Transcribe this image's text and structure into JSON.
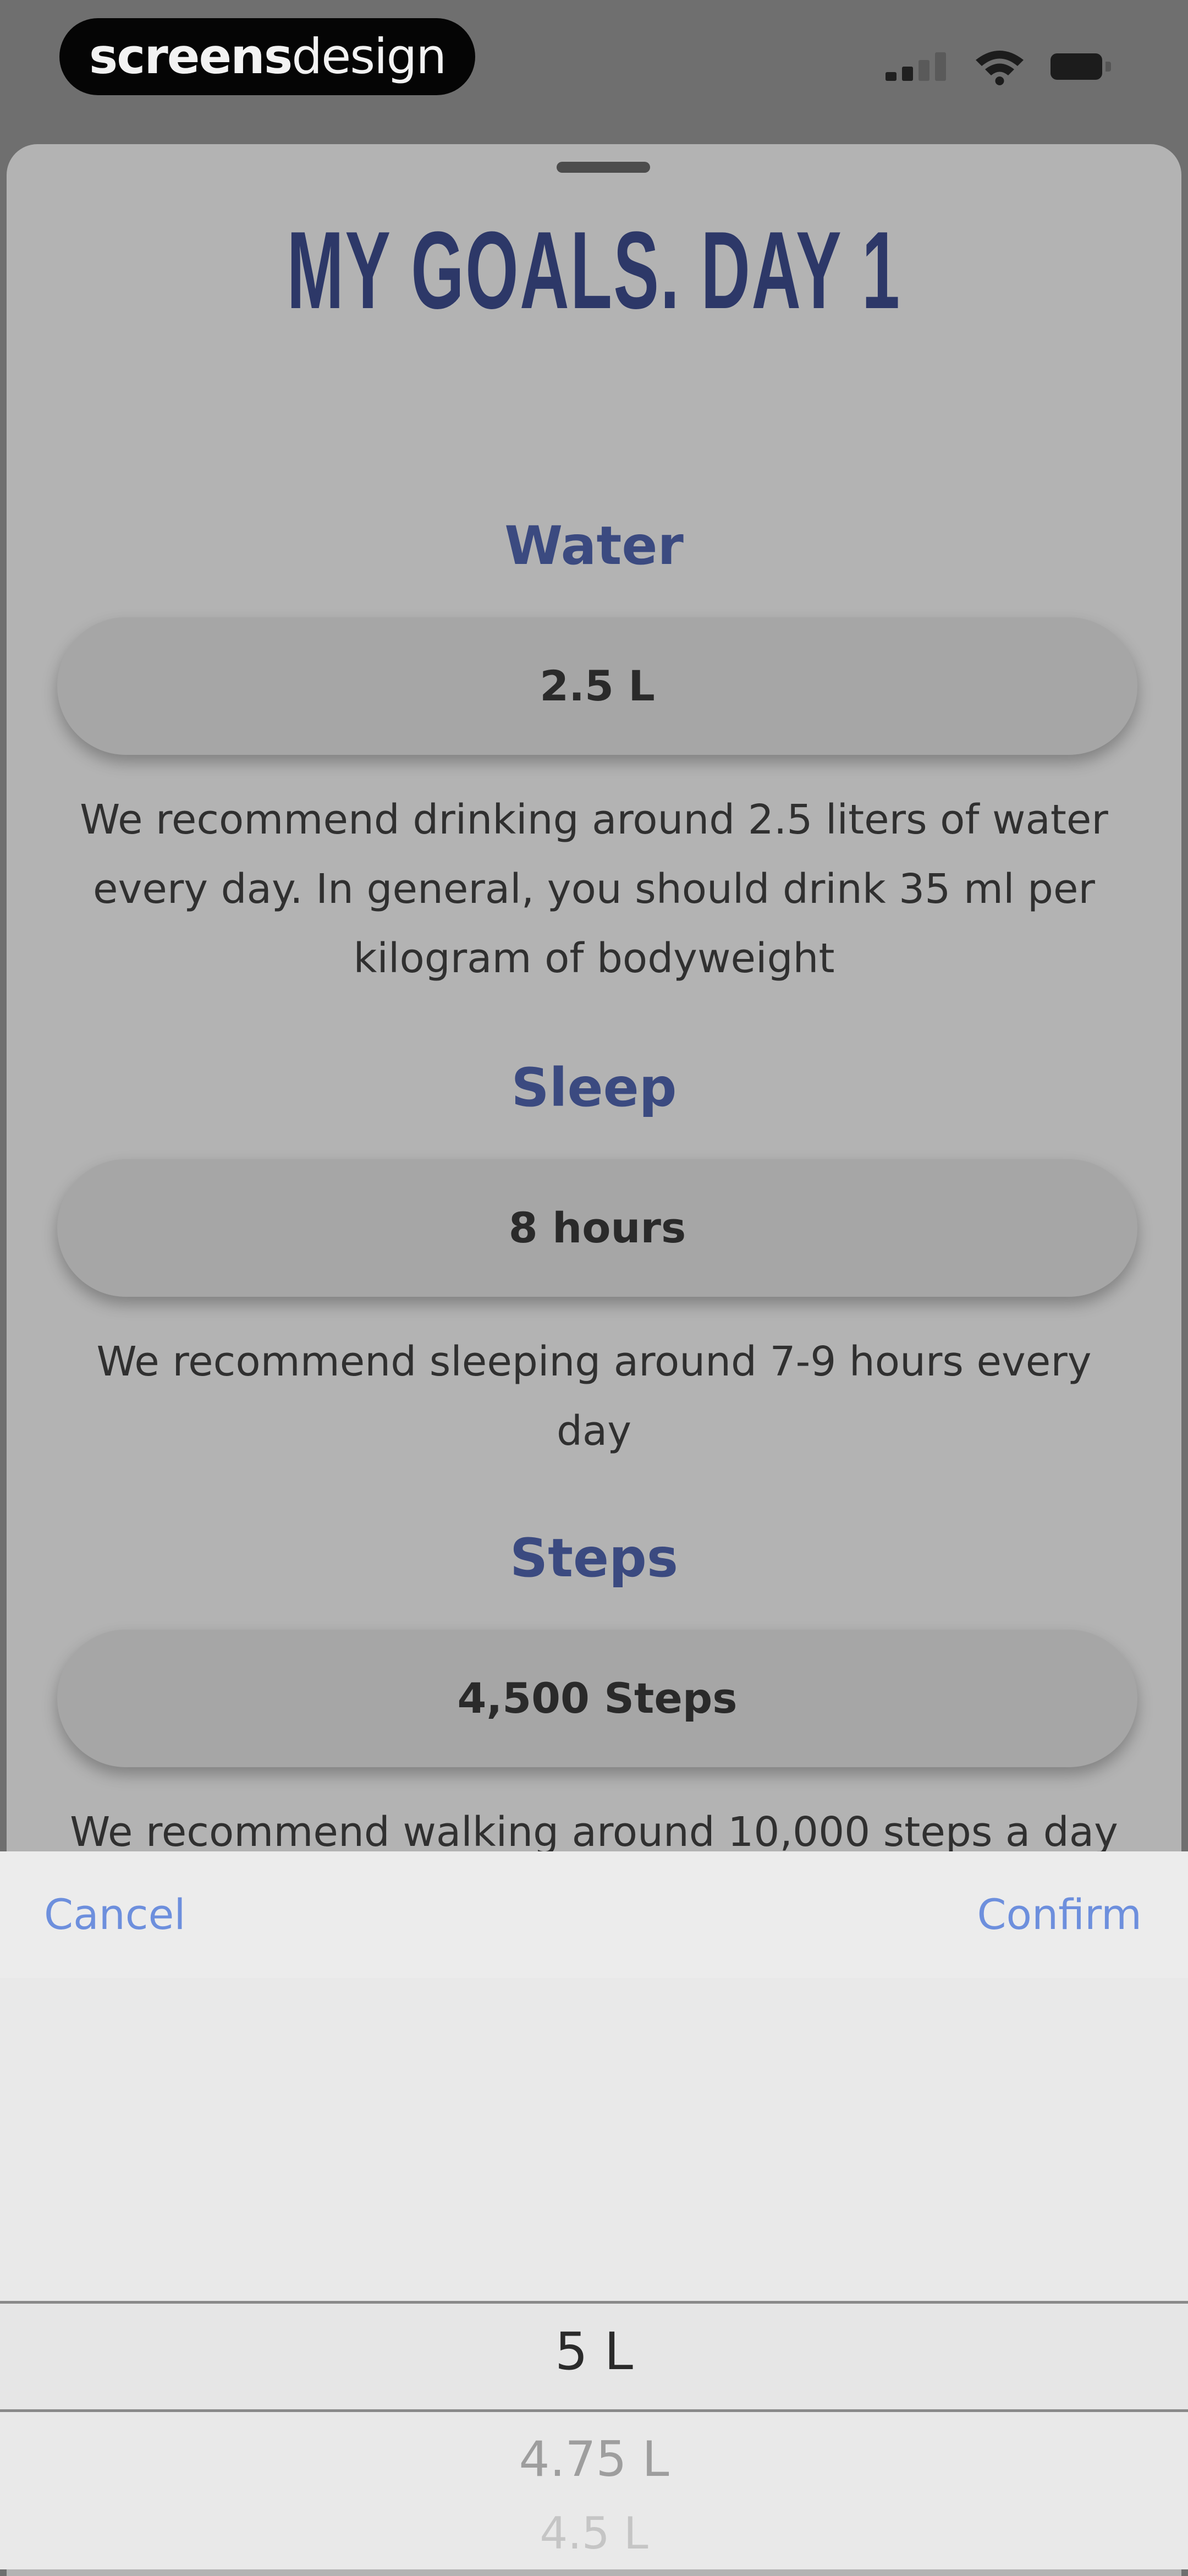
{
  "status_bar": {
    "brand_bold": "screens",
    "brand_light": "design",
    "icons": [
      "signal-icon",
      "wifi-icon",
      "battery-icon"
    ]
  },
  "sheet": {
    "title": "MY GOALS. DAY 1",
    "goals": [
      {
        "heading": "Water",
        "value": "2.5 L",
        "hint": "We recommend drinking around 2.5 liters of water every day. In general, you should drink 35 ml per kilogram of bodyweight"
      },
      {
        "heading": "Sleep",
        "value": "8 hours",
        "hint": "We recommend sleeping around 7-9 hours every day"
      },
      {
        "heading": "Steps",
        "value": "4,500 Steps",
        "hint": "We recommend walking around 10,000 steps a day"
      }
    ]
  },
  "picker": {
    "cancel_label": "Cancel",
    "confirm_label": "Confirm",
    "options": [
      "5 L",
      "4.75 L",
      "4.5 L"
    ],
    "selected": "5 L"
  },
  "colors": {
    "title": "#2d3868",
    "heading": "#3b4a80",
    "picker_button": "#6d8fdd"
  }
}
